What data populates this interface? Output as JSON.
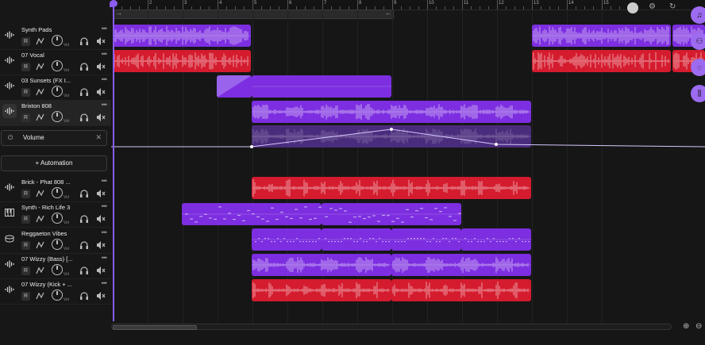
{
  "ruler": {
    "labels": [
      "1",
      "2",
      "3",
      "4",
      "5",
      "6",
      "7",
      "8",
      "9",
      "10",
      "11",
      "12",
      "13",
      "14",
      "15"
    ]
  },
  "tracks": [
    {
      "name": "Synth Pads",
      "icon": "waveform-icon"
    },
    {
      "name": "07 Vocal",
      "icon": "waveform-icon"
    },
    {
      "name": "03 Sunsets (FX I...",
      "icon": "waveform-icon"
    },
    {
      "name": "Brixton 808",
      "icon": "waveform-icon",
      "selected": true
    },
    {
      "name": "Brick - Phat 808 ...",
      "icon": "waveform-icon"
    },
    {
      "name": "Synth - Rich Life 3",
      "icon": "keyboard-icon"
    },
    {
      "name": "Reggaeton Vibes",
      "icon": "drum-icon"
    },
    {
      "name": "07 Wizzy (Bass) [...",
      "icon": "waveform-icon"
    },
    {
      "name": "07 Wizzy (Kick + ...",
      "icon": "waveform-icon"
    }
  ],
  "track_controls": {
    "record_label": "R",
    "volume_label": "Vol",
    "more_label": "•••"
  },
  "automation": {
    "parameter": "Volume",
    "add_label": "+ Automation",
    "close_label": "✕"
  },
  "loop": {
    "left_arrow": "→",
    "right_arrow": "←"
  },
  "colors": {
    "purple": "#7c2ee0",
    "red": "#d41c2e",
    "accent": "#9d6bf0",
    "background": "#141414"
  },
  "right_tools": [
    {
      "icon": "music-note-icon",
      "glyph": "♫"
    },
    {
      "icon": "collaborators-icon",
      "glyph": "⚇"
    },
    {
      "icon": "chat-icon",
      "glyph": "◌"
    },
    {
      "icon": "mixer-icon",
      "glyph": "⫼"
    }
  ]
}
